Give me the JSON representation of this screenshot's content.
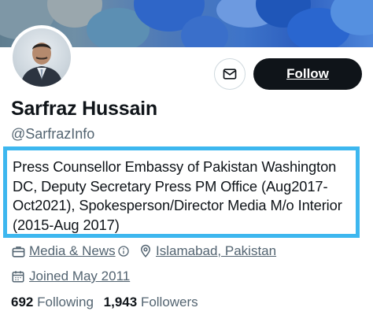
{
  "profile": {
    "name": "Sarfraz Hussain",
    "handle": "@SarfrazInfo",
    "bio": "Press Counsellor Embassy of Pakistan Washington DC, Deputy Secretary Press PM Office (Aug2017-Oct2021), Spokesperson/Director Media M/o Interior (2015-Aug 2017)",
    "category": "Media & News",
    "category_info_icon": "info-icon",
    "location": "Islamabad, Pakistan",
    "joined": "Joined May 2011",
    "following_count": "692",
    "following_label": "Following",
    "followers_count": "1,943",
    "followers_label": "Followers"
  },
  "actions": {
    "message_icon": "mail-icon",
    "follow_label": "Follow"
  },
  "colors": {
    "highlight_border": "#3db7ef",
    "follow_bg": "#0f1419",
    "secondary_text": "#536471"
  }
}
